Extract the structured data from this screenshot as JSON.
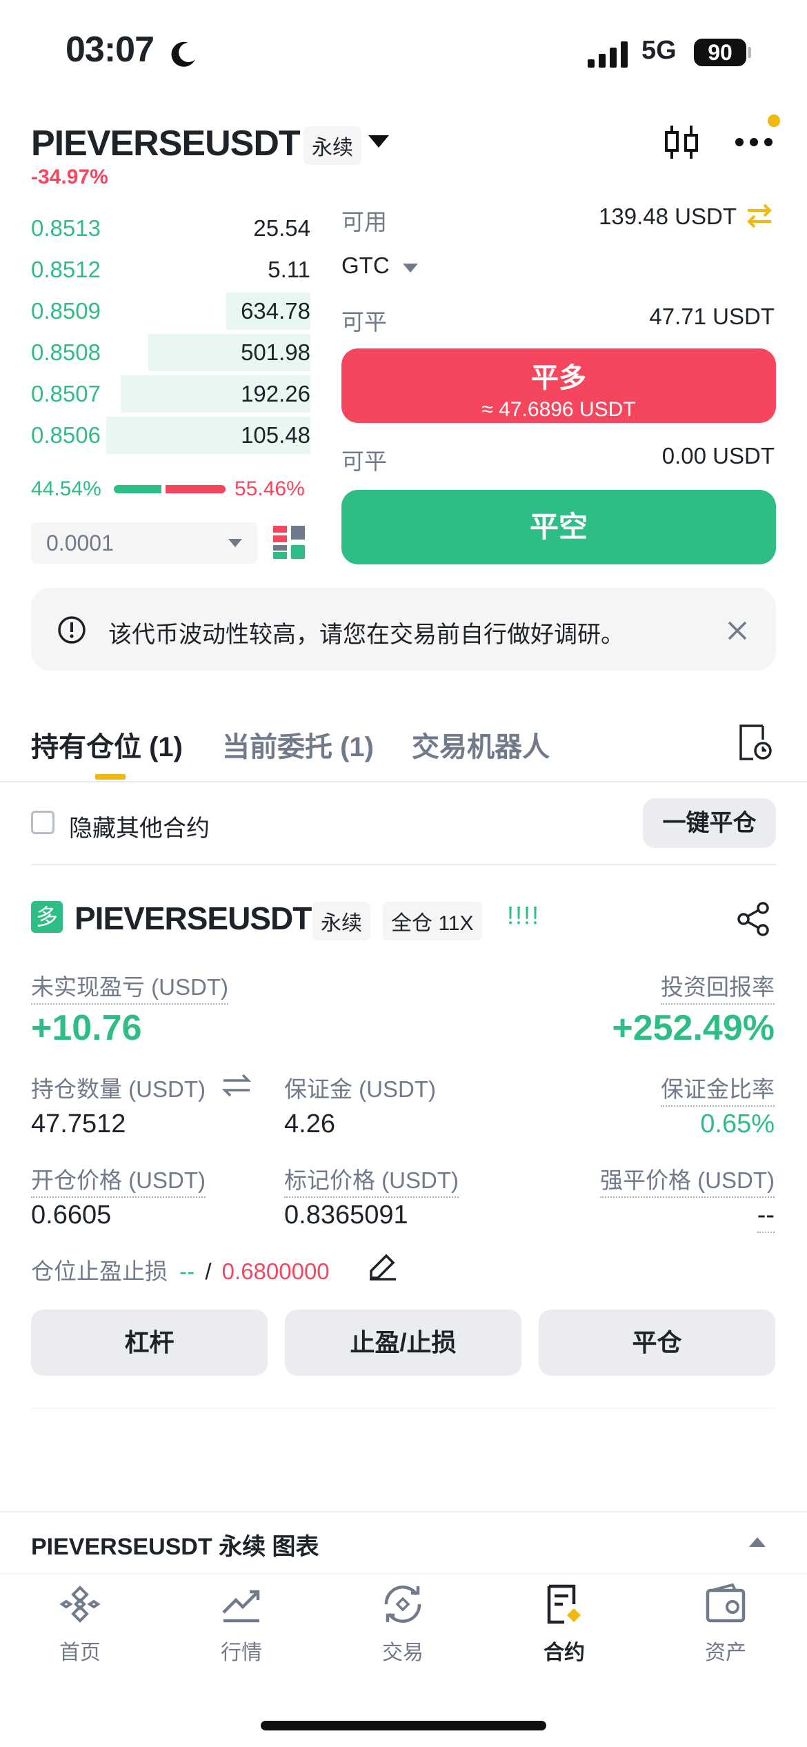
{
  "status_bar": {
    "time": "03:07",
    "network": "5G",
    "battery": "90"
  },
  "header": {
    "pair": "PIEVERSEUSDT",
    "contract_tag": "永续",
    "change": "-34.97%"
  },
  "order_book": {
    "asks": [
      {
        "price": "0.8513",
        "qty": "25.54",
        "depth": 0.0
      },
      {
        "price": "0.8512",
        "qty": "5.11",
        "depth": 0.0
      },
      {
        "price": "0.8509",
        "qty": "634.78",
        "depth": 0.3
      },
      {
        "price": "0.8508",
        "qty": "501.98",
        "depth": 0.58
      },
      {
        "price": "0.8507",
        "qty": "192.26",
        "depth": 0.68
      },
      {
        "price": "0.8506",
        "qty": "105.48",
        "depth": 0.73
      }
    ],
    "buy_ratio": "44.54%",
    "sell_ratio": "55.46%",
    "buy_fraction": 0.4454,
    "precision": "0.0001"
  },
  "trade_panel": {
    "available_label": "可用",
    "available_value": "139.48 USDT",
    "order_type": "GTC",
    "closable_label_1": "可平",
    "closable_value_1": "47.71 USDT",
    "close_long_label": "平多",
    "close_long_sub": "≈ 47.6896 USDT",
    "closable_label_2": "可平",
    "closable_value_2": "0.00 USDT",
    "close_short_label": "平空"
  },
  "notice": {
    "text": "该代币波动性较高，请您在交易前自行做好调研。"
  },
  "tabs": [
    {
      "label": "持有仓位 (1)"
    },
    {
      "label": "当前委托 (1)"
    },
    {
      "label": "交易机器人"
    }
  ],
  "filter": {
    "hide_others": "隐藏其他合约",
    "close_all": "一键平仓"
  },
  "position": {
    "side_badge": "多",
    "pair": "PIEVERSEUSDT",
    "contract_tag": "永续",
    "margin_tag": "全仓 11X",
    "signal": "!!!!",
    "pnl_label": "未实现盈亏 (USDT)",
    "pnl_value": "+10.76",
    "roi_label": "投资回报率",
    "roi_value": "+252.49%",
    "size_label": "持仓数量 (USDT)",
    "size_value": "47.7512",
    "margin_label": "保证金 (USDT)",
    "margin_value": "4.26",
    "margin_ratio_label": "保证金比率",
    "margin_ratio_value": "0.65%",
    "entry_label": "开仓价格 (USDT)",
    "entry_value": "0.6605",
    "mark_label": "标记价格 (USDT)",
    "mark_value": "0.8365091",
    "liq_label": "强平价格 (USDT)",
    "liq_value": "--",
    "tpsl_label": "仓位止盈止损",
    "tp_value": "--",
    "separator": "/",
    "sl_value": "0.6800000",
    "actions": [
      "杠杆",
      "止盈/止损",
      "平仓"
    ]
  },
  "chart_bar": {
    "label": "PIEVERSEUSDT 永续 图表"
  },
  "nav": [
    {
      "label": "首页",
      "icon": "binance-logo-icon"
    },
    {
      "label": "行情",
      "icon": "chart-trend-icon"
    },
    {
      "label": "交易",
      "icon": "exchange-icon"
    },
    {
      "label": "合约",
      "icon": "futures-icon"
    },
    {
      "label": "资产",
      "icon": "wallet-icon"
    }
  ],
  "colors": {
    "green": "#2ebd85",
    "red": "#f6465d",
    "yellow": "#f0b90b"
  }
}
